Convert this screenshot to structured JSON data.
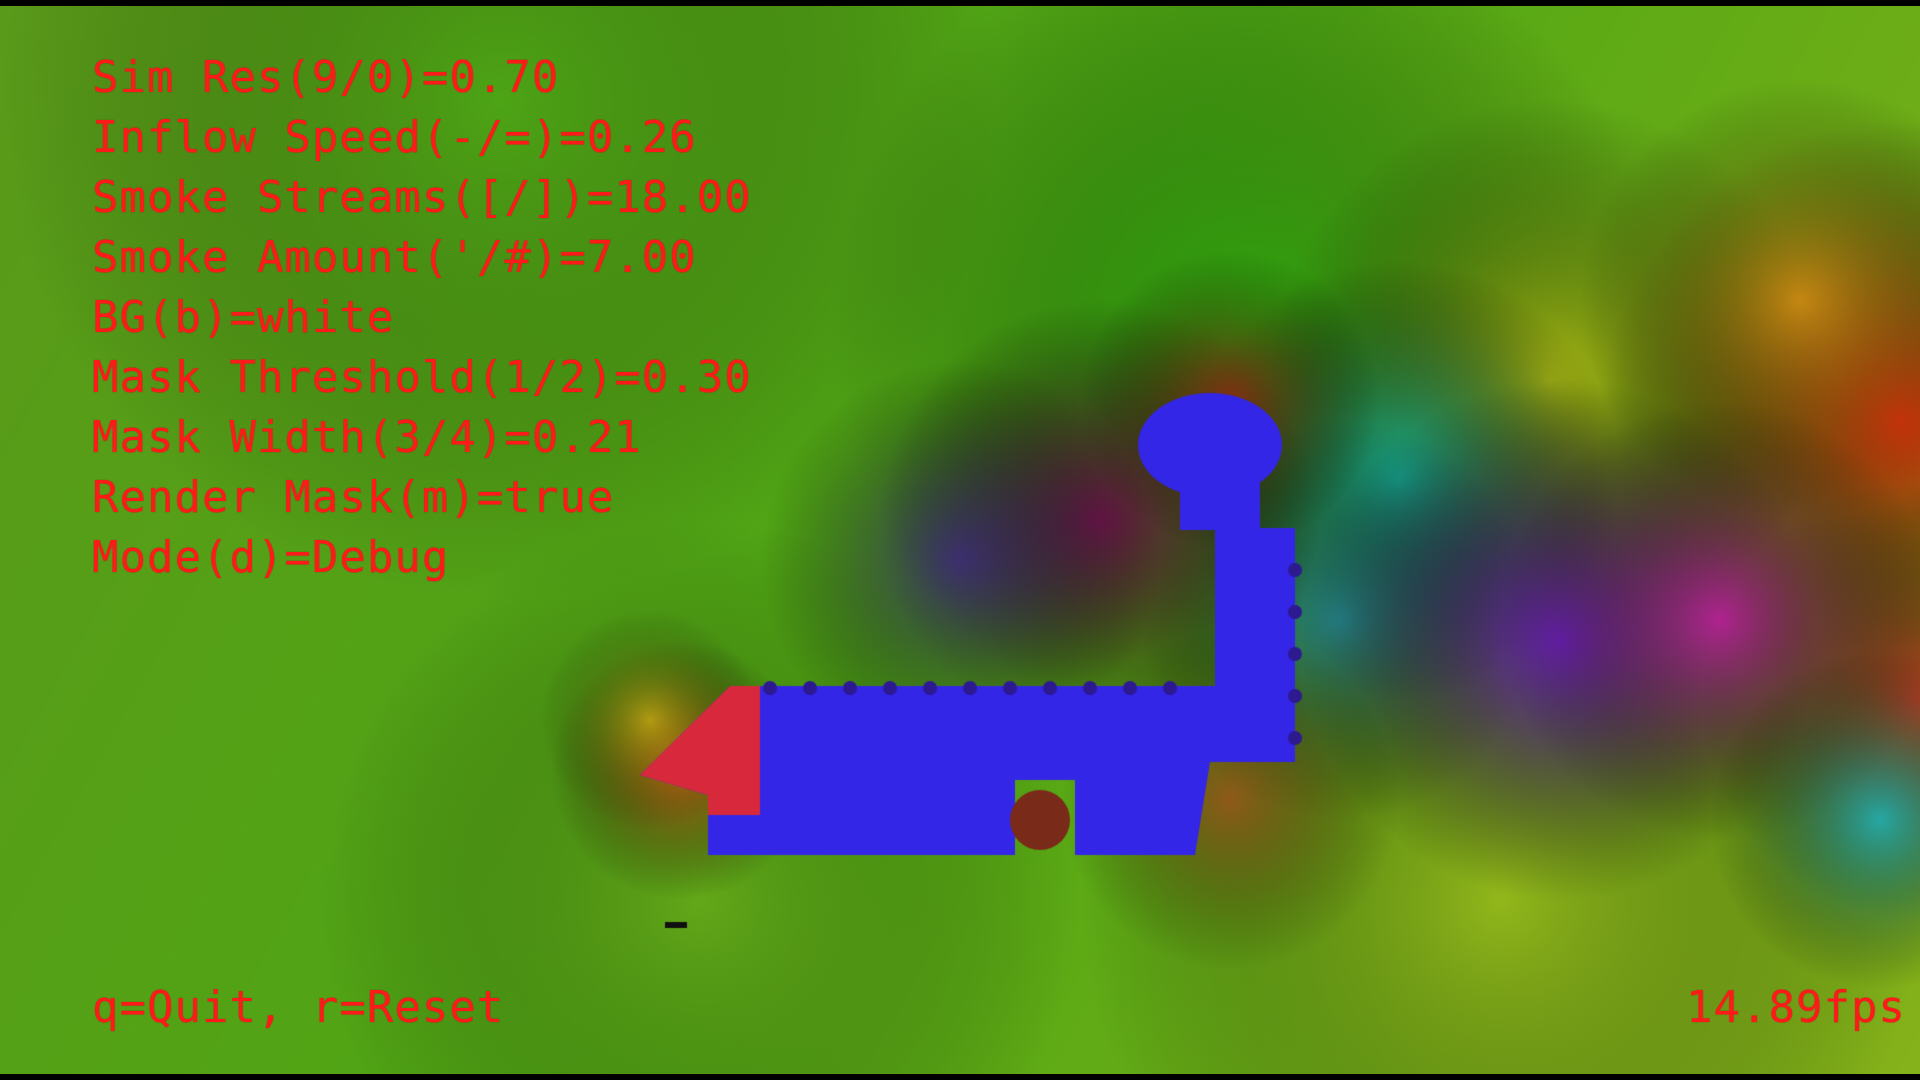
{
  "hud": {
    "params": [
      "Sim Res(9/0)=0.70",
      "Inflow Speed(-/=)=0.26",
      "Smoke Streams([/])=18.00",
      "Smoke Amount('/#)=7.00",
      "BG(b)=white",
      "Mask Threshold(1/2)=0.30",
      "Mask Width(3/4)=0.21",
      "Render Mask(m)=true",
      "Mode(d)=Debug"
    ],
    "help": "q=Quit, r=Reset",
    "fps": "14.89fps"
  },
  "colors": {
    "hud_text": "#ff1a1a",
    "mask": "#3326e6",
    "field_base": "#5aa61c"
  }
}
